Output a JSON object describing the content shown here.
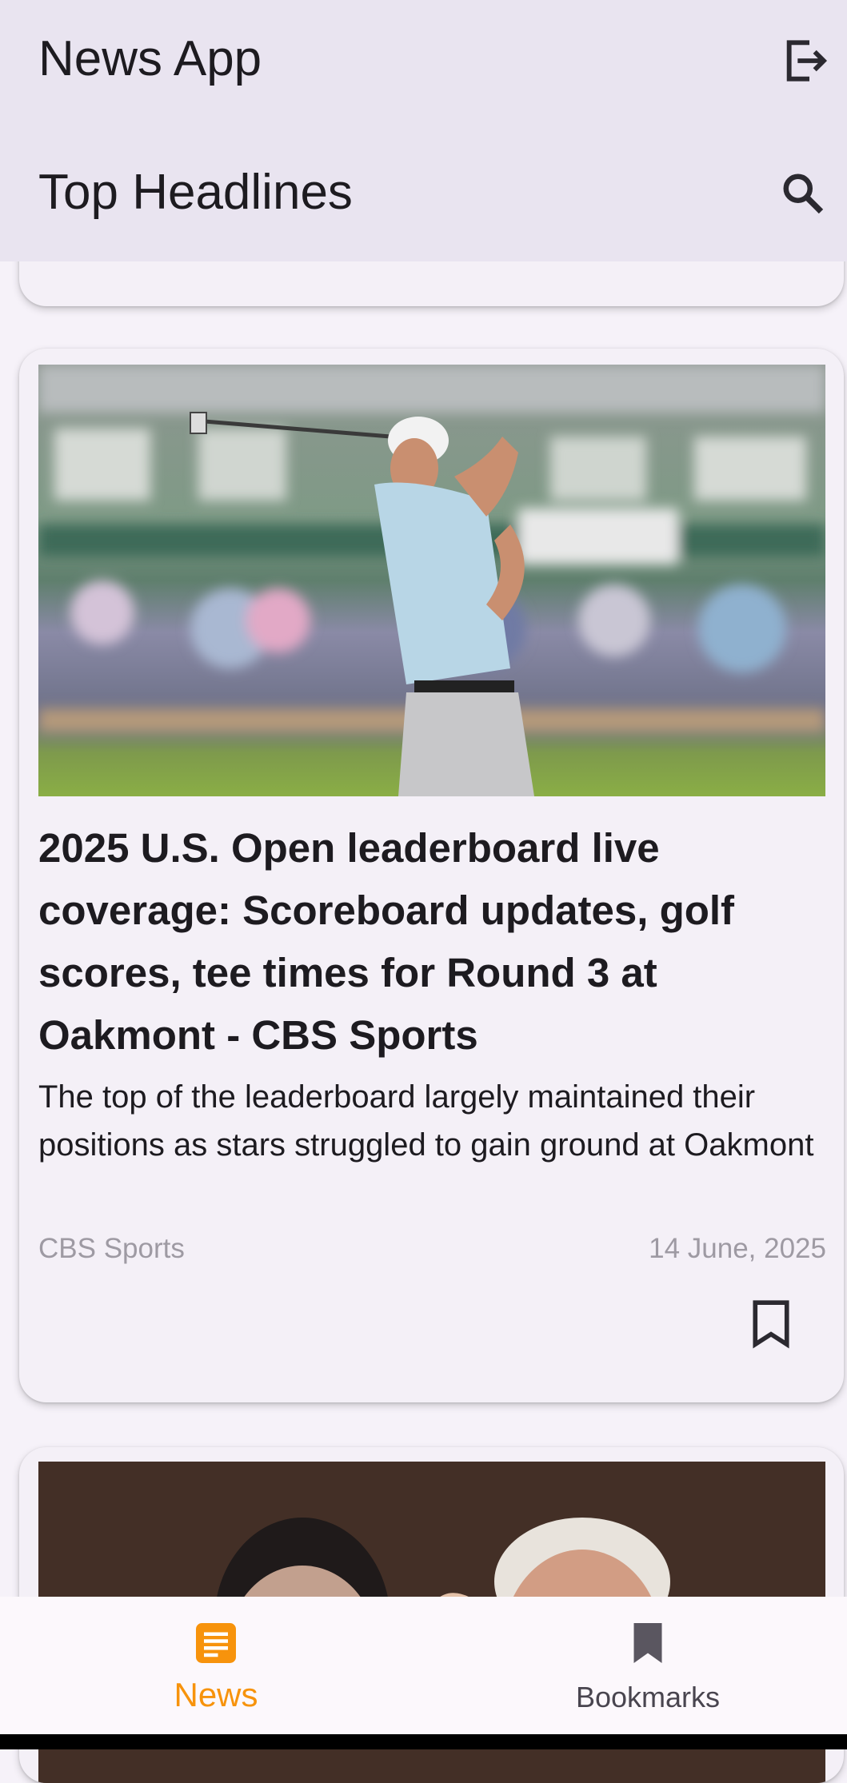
{
  "app": {
    "title": "News App",
    "section_title": "Top Headlines",
    "accent_color": "#f7930c"
  },
  "header_icons": {
    "logout": "logout-icon",
    "search": "search-icon"
  },
  "article": {
    "image": "golfer-swing-photo",
    "headline": "2025 U.S. Open leaderboard live coverage: Scoreboard updates, golf scores, tee times for Round 3 at Oakmont - CBS Sports",
    "description": "The top of the leaderboard largely maintained their positions as stars struggled to gain ground at Oakmont",
    "source": "CBS Sports",
    "date": "14 June, 2025",
    "bookmark_icon": "bookmark-outline-icon"
  },
  "next_article": {
    "image": "two-men-photo"
  },
  "bottom_nav": {
    "items": [
      {
        "label": "News",
        "icon": "article-icon",
        "active": true
      },
      {
        "label": "Bookmarks",
        "icon": "bookmark-icon",
        "active": false
      }
    ]
  }
}
